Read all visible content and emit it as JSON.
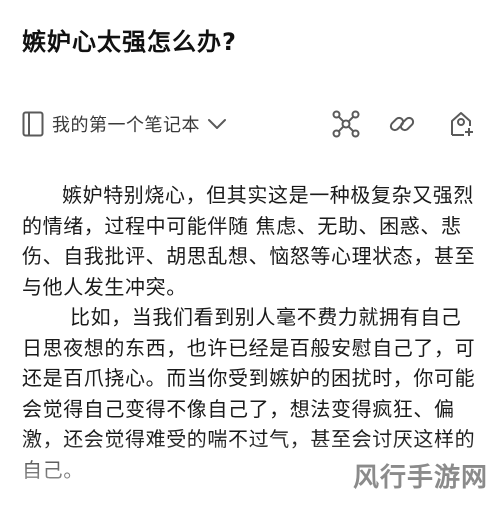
{
  "article": {
    "title": "嫉妒心太强怎么办?",
    "paragraphs": [
      "嫉妒特别烧心，但其实这是一种极复杂又强烈的情绪，过程中可能伴随 焦虑、无助、困惑、悲伤、自我批评、胡思乱想、恼怒等心理状态，甚至与他人发生冲突。",
      "比如，当我们看到别人毫不费力就拥有自己日思夜想的东西，也许已经是百般安慰自己了，可还是百爪挠心。而当你受到嫉妒的困扰时，你可能会觉得自己变得不像自己了，想法变得疯狂、偏激，还会觉得难受的喘不过气，甚至会讨厌这样的自己。"
    ]
  },
  "toolbar": {
    "notebook_label": "我的第一个笔记本",
    "icons": [
      "notebook-icon",
      "chevron-down-icon",
      "mind-map-icon",
      "link-icon",
      "share-person-icon"
    ]
  },
  "watermark": {
    "text": "风行手游网"
  },
  "colors": {
    "text": "#1a1a1a",
    "icon": "#5a5a5a",
    "background": "#ffffff"
  }
}
